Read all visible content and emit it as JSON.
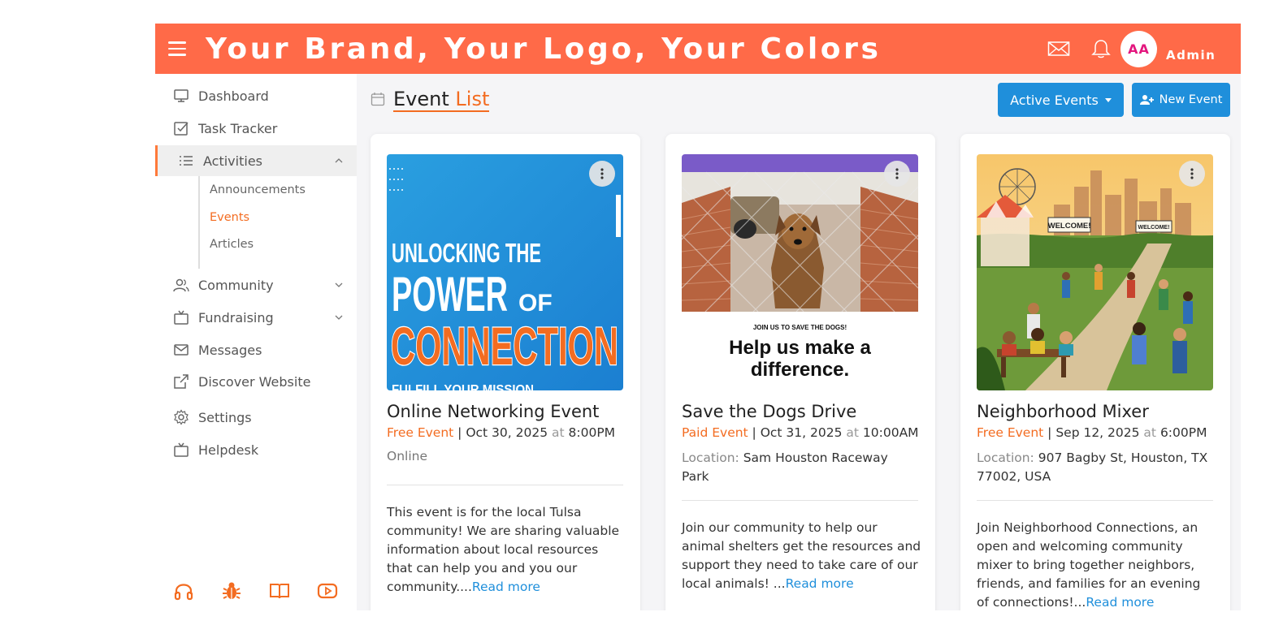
{
  "header": {
    "brand": "Your Brand, Your Logo, Your Colors",
    "avatar_initials": "AA",
    "user_name": "Admin",
    "color": "#ff6a48"
  },
  "sidebar": {
    "items": [
      {
        "label": "Dashboard",
        "icon": "monitor-icon"
      },
      {
        "label": "Task Tracker",
        "icon": "checkbox-icon"
      },
      {
        "label": "Activities",
        "icon": "list-icon"
      },
      {
        "label": "Community",
        "icon": "users-icon"
      },
      {
        "label": "Fundraising",
        "icon": "tv-icon"
      },
      {
        "label": "Messages",
        "icon": "mail-icon"
      },
      {
        "label": "Discover Website",
        "icon": "external-link-icon"
      },
      {
        "label": "Settings",
        "icon": "gear-icon"
      },
      {
        "label": "Helpdesk",
        "icon": "tv-icon"
      }
    ],
    "sub_items": [
      "Announcements",
      "Events",
      "Articles"
    ],
    "bottom_icons": [
      "headphones-icon",
      "bug-icon",
      "book-icon",
      "youtube-icon"
    ]
  },
  "main": {
    "title_part1": "Event",
    "title_part2": "List",
    "filter_button": "Active Events",
    "new_button": "New Event"
  },
  "events": [
    {
      "title": "Online Networking Event",
      "type": "Free Event",
      "date": "Oct 30, 2025",
      "at": "at",
      "time": "8:00PM",
      "location": "Online",
      "description": "This event is for the local Tulsa community! We are sharing valuable information about local resources that can help you and you our community....",
      "read_more": "Read more",
      "image_text": {
        "line1": "UNLOCKING THE",
        "line2": "POWER",
        "line2b": "OF",
        "line3": "CONNECTION",
        "line4": "FULFILL YOUR MISSION"
      }
    },
    {
      "title": "Save the Dogs Drive",
      "type": "Paid Event",
      "date": "Oct 31, 2025",
      "at": "at",
      "time": "10:00AM",
      "location_label": "Location:",
      "location": "Sam Houston Raceway Park",
      "description": "Join our community to help our animal shelters get the resources and support they need to take care of our local animals! ...",
      "read_more": "Read more",
      "image_text": {
        "small": "JOIN US TO SAVE THE DOGS!",
        "big1": "Help us make a",
        "big2": "difference."
      }
    },
    {
      "title": "Neighborhood Mixer",
      "type": "Free Event",
      "date": "Sep 12, 2025",
      "at": "at",
      "time": "6:00PM",
      "location_label": "Location:",
      "location": "907 Bagby St, Houston, TX 77002, USA",
      "description": "Join Neighborhood Connections, an open and welcoming community mixer to bring together neighbors, friends, and families for an evening of connections!...",
      "read_more": "Read more",
      "image_text": {
        "sign1": "WELCOME!",
        "sign2": "WELCOME!"
      }
    }
  ]
}
